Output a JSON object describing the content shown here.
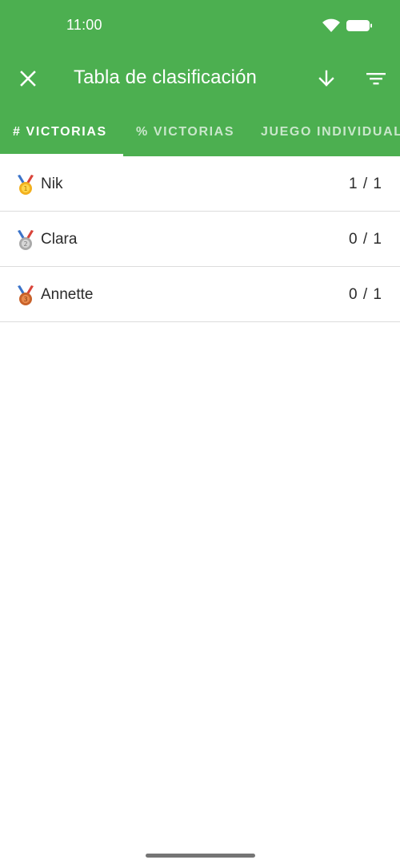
{
  "status_bar": {
    "time": "11:00",
    "icons": [
      "wifi-icon",
      "battery-icon"
    ]
  },
  "toolbar": {
    "title": "Tabla de clasificación",
    "close_icon": "close-icon",
    "sort_icon": "arrow-down-icon",
    "filter_icon": "filter-icon"
  },
  "tabs": [
    {
      "label": "# VICTORIAS",
      "active": true
    },
    {
      "label": "% VICTORIAS",
      "active": false
    },
    {
      "label": "JUEGO INDIVIDUAL",
      "active": false
    }
  ],
  "leaderboard": [
    {
      "medal": "gold-medal-icon",
      "name": "Nik",
      "score": "1 / 1"
    },
    {
      "medal": "silver-medal-icon",
      "name": "Clara",
      "score": "0 / 1"
    },
    {
      "medal": "bronze-medal-icon",
      "name": "Annette",
      "score": "0 / 1"
    }
  ],
  "colors": {
    "primary": "#4caf50",
    "on_primary": "#ffffff",
    "text": "#2b2b2b",
    "divider": "#dcdcdc"
  }
}
